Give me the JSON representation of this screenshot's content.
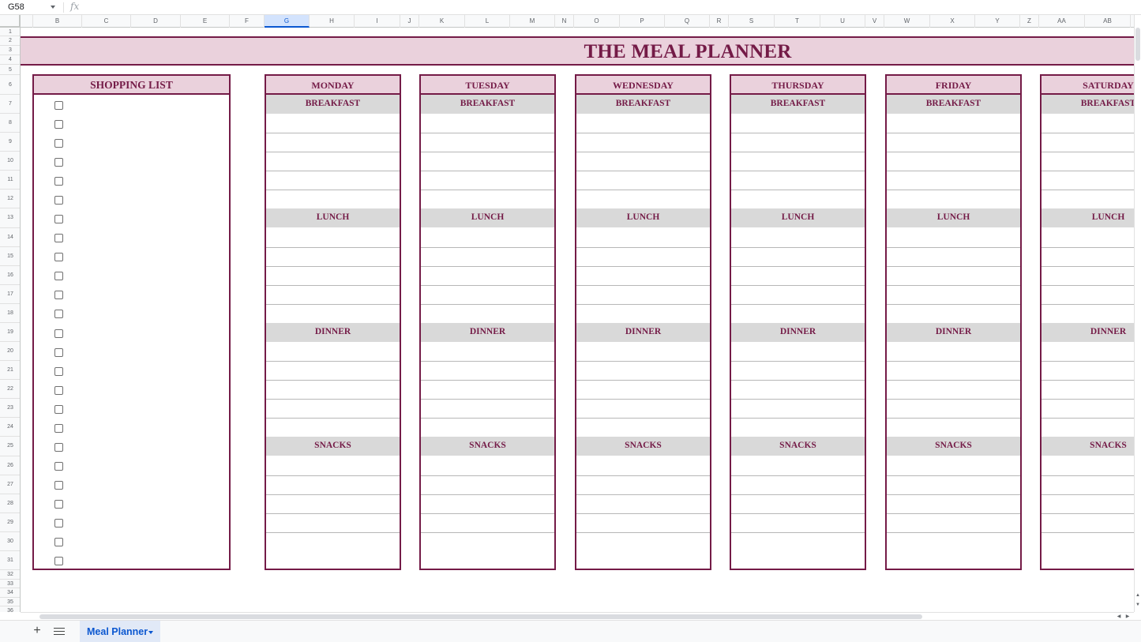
{
  "formula_bar": {
    "name_box": "G58",
    "fx_label": "fx",
    "formula": ""
  },
  "columns": [
    "B",
    "C",
    "D",
    "E",
    "F",
    "G",
    "H",
    "I",
    "J",
    "K",
    "L",
    "M",
    "N",
    "O",
    "P",
    "Q",
    "R",
    "S",
    "T",
    "U",
    "V",
    "W",
    "X",
    "Y",
    "Z",
    "AA",
    "AB"
  ],
  "selected_column": "G",
  "rows": [
    "1",
    "2",
    "3",
    "4",
    "5",
    "6",
    "7",
    "8",
    "9",
    "10",
    "11",
    "12",
    "13",
    "14",
    "15",
    "16",
    "17",
    "18",
    "19",
    "20",
    "21",
    "22",
    "23",
    "24",
    "25",
    "26",
    "27",
    "28",
    "29",
    "30",
    "31",
    "32",
    "33",
    "34",
    "35",
    "36"
  ],
  "title": "THE MEAL PLANNER",
  "shopping_list": {
    "heading": "SHOPPING LIST",
    "items": [
      {
        "checked": false,
        "text": ""
      },
      {
        "checked": false,
        "text": ""
      },
      {
        "checked": false,
        "text": ""
      },
      {
        "checked": false,
        "text": ""
      },
      {
        "checked": false,
        "text": ""
      },
      {
        "checked": false,
        "text": ""
      },
      {
        "checked": false,
        "text": ""
      },
      {
        "checked": false,
        "text": ""
      },
      {
        "checked": false,
        "text": ""
      },
      {
        "checked": false,
        "text": ""
      },
      {
        "checked": false,
        "text": ""
      },
      {
        "checked": false,
        "text": ""
      },
      {
        "checked": false,
        "text": ""
      },
      {
        "checked": false,
        "text": ""
      },
      {
        "checked": false,
        "text": ""
      },
      {
        "checked": false,
        "text": ""
      },
      {
        "checked": false,
        "text": ""
      },
      {
        "checked": false,
        "text": ""
      },
      {
        "checked": false,
        "text": ""
      },
      {
        "checked": false,
        "text": ""
      },
      {
        "checked": false,
        "text": ""
      },
      {
        "checked": false,
        "text": ""
      },
      {
        "checked": false,
        "text": ""
      },
      {
        "checked": false,
        "text": ""
      },
      {
        "checked": false,
        "text": ""
      }
    ]
  },
  "days": [
    {
      "name": "MONDAY"
    },
    {
      "name": "TUESDAY"
    },
    {
      "name": "WEDNESDAY"
    },
    {
      "name": "THURSDAY"
    },
    {
      "name": "FRIDAY"
    },
    {
      "name": "SATURDAY"
    }
  ],
  "meal_sections": [
    {
      "label": "BREAKFAST",
      "entries": [
        "",
        "",
        "",
        "",
        ""
      ]
    },
    {
      "label": "LUNCH",
      "entries": [
        "",
        "",
        "",
        "",
        ""
      ]
    },
    {
      "label": "DINNER",
      "entries": [
        "",
        "",
        "",
        "",
        ""
      ]
    },
    {
      "label": "SNACKS",
      "entries": [
        "",
        "",
        "",
        "",
        ""
      ]
    }
  ],
  "colors": {
    "accent": "#741b47",
    "header_fill": "#ead1dc",
    "section_fill": "#d9d9d9"
  },
  "sheet_tabs": {
    "add_icon": "+",
    "active_tab": "Meal Planner"
  }
}
